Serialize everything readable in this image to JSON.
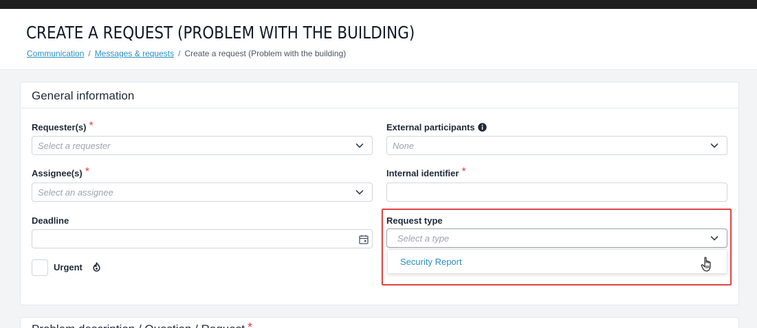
{
  "header": {
    "title": "CREATE A REQUEST (PROBLEM WITH THE BUILDING)",
    "breadcrumb": [
      {
        "label": "Communication",
        "link": true
      },
      {
        "label": "Messages & requests",
        "link": true
      },
      {
        "label": "Create a request (Problem with the building)",
        "link": false
      }
    ],
    "separator": "/"
  },
  "general": {
    "title": "General information",
    "required_mark": "*",
    "requester": {
      "label": "Requester(s)",
      "placeholder": "Select a requester"
    },
    "assignee": {
      "label": "Assignee(s)",
      "placeholder": "Select an assignee"
    },
    "deadline": {
      "label": "Deadline",
      "value": ""
    },
    "urgent": {
      "label": "Urgent",
      "checked": false
    },
    "external": {
      "label": "External participants",
      "value": "None"
    },
    "internal_id": {
      "label": "Internal identifier",
      "value": ""
    },
    "request_type": {
      "label": "Request type",
      "placeholder": "Select a type",
      "options": [
        "Security Report"
      ]
    }
  },
  "problem": {
    "title": "Problem description / Question / Request"
  },
  "colors": {
    "accent": "#2b8fc4",
    "required": "#e53e3e",
    "highlight": "#e04848"
  }
}
